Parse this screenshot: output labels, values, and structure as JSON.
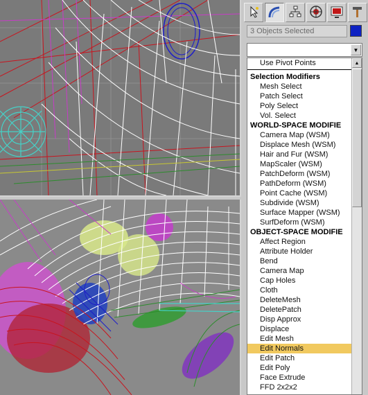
{
  "command_panel": {
    "tabs": [
      {
        "name": "create-tab",
        "icon": "cursor-star-icon"
      },
      {
        "name": "modify-tab",
        "icon": "bent-pipe-icon"
      },
      {
        "name": "hierarchy-tab",
        "icon": "hierarchy-icon"
      },
      {
        "name": "motion-tab",
        "icon": "wheel-icon"
      },
      {
        "name": "display-tab",
        "icon": "monitor-icon"
      },
      {
        "name": "utilities-tab",
        "icon": "hammer-icon"
      }
    ],
    "selection_text": "3 Objects Selected",
    "color_swatch": "#0e22c2",
    "modifier_dropdown_value": "",
    "modifier_list": {
      "pivot_item": "Use Pivot Points",
      "sections": [
        {
          "header": "Selection Modifiers",
          "items": [
            "Mesh Select",
            "Patch Select",
            "Poly Select",
            "Vol. Select"
          ]
        },
        {
          "header": "WORLD-SPACE MODIFIE",
          "items": [
            "Camera Map (WSM)",
            "Displace Mesh (WSM)",
            "Hair and Fur (WSM)",
            "MapScaler (WSM)",
            "PatchDeform (WSM)",
            "PathDeform (WSM)",
            "Point Cache (WSM)",
            "Subdivide (WSM)",
            "Surface Mapper (WSM)",
            "SurfDeform (WSM)"
          ]
        },
        {
          "header": "OBJECT-SPACE MODIFIE",
          "items": [
            "Affect Region",
            "Attribute Holder",
            "Bend",
            "Camera Map",
            "Cap Holes",
            "Cloth",
            "DeleteMesh",
            "DeletePatch",
            "Disp Approx",
            "Displace",
            "Edit Mesh",
            "Edit Normals",
            "Edit Patch",
            "Edit Poly",
            "Face Extrude",
            "FFD 2x2x2"
          ]
        }
      ],
      "selected_item": "Edit Normals"
    }
  },
  "colors": {
    "viewport_bg": "#7a7a7a",
    "selection_highlight": "#f1c95f",
    "wire_white": "#ffffff",
    "wire_red": "#c8141e",
    "wire_magenta": "#c83cc8",
    "wire_blue": "#1e1ec8",
    "wire_green": "#2c8c2c",
    "wire_cyan": "#46d2c8"
  }
}
